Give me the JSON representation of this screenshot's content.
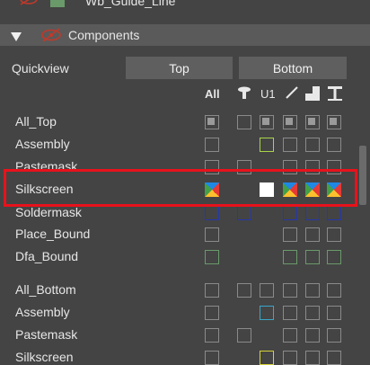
{
  "top_row": {
    "label": "Wb_Guide_Line"
  },
  "section": {
    "label": "Components"
  },
  "quickview": {
    "label": "Quickview",
    "top_button": "Top",
    "bottom_button": "Bottom"
  },
  "columns": {
    "all": "All",
    "u1": "U1"
  },
  "rows": [
    {
      "label": "All_Top"
    },
    {
      "label": "Assembly"
    },
    {
      "label": "Pastemask"
    },
    {
      "label": "Silkscreen"
    },
    {
      "label": "Soldermask"
    },
    {
      "label": "Place_Bound"
    },
    {
      "label": "Dfa_Bound"
    },
    {
      "label": "All_Bottom"
    },
    {
      "label": "Assembly"
    },
    {
      "label": "Pastemask"
    },
    {
      "label": "Silkscreen"
    }
  ],
  "colors": {
    "highlight": "#e8121b",
    "background": "#444444",
    "header": "#5a5a5a",
    "swatch_guide": "#6a9a6a"
  }
}
